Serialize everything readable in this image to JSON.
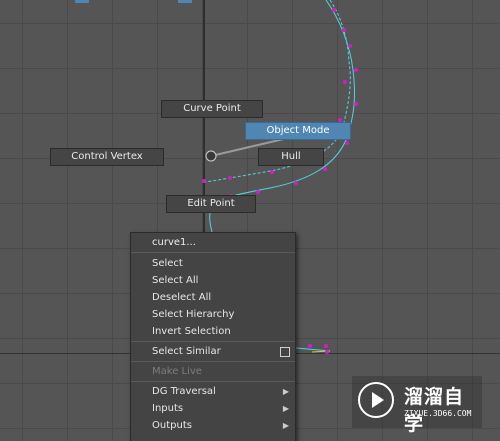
{
  "marking_menu": {
    "curve_point": "Curve Point",
    "object_mode": "Object Mode",
    "control_vertex": "Control Vertex",
    "hull": "Hull",
    "edit_point": "Edit Point"
  },
  "context_menu": {
    "title": "curve1...",
    "items": [
      {
        "label": "Select"
      },
      {
        "label": "Select All"
      },
      {
        "label": "Deselect All"
      },
      {
        "label": "Select Hierarchy"
      },
      {
        "label": "Invert Selection"
      },
      {
        "label": "Select Similar"
      },
      {
        "label": "Make Live"
      },
      {
        "label": "DG Traversal"
      },
      {
        "label": "Inputs"
      },
      {
        "label": "Outputs"
      }
    ]
  },
  "watermark": {
    "title": "溜溜自学",
    "subtitle": "ZIXUE.3D66.COM",
    "icon": "play-icon"
  },
  "colors": {
    "curve": "#4fd6e0",
    "cv_point": "#d21fc5",
    "highlight": "#4f86b3",
    "viewport_bg": "#555555"
  }
}
